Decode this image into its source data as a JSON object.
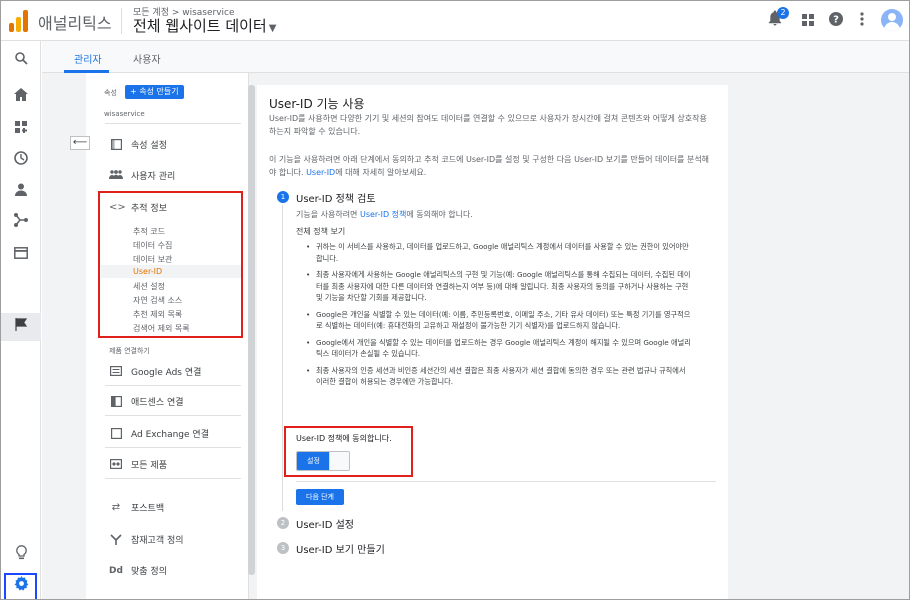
{
  "app": {
    "name": "애널리틱스",
    "breadcrumb": "모든 계정 > wisaservice",
    "property_title": "전체 웹사이트 데이터",
    "notification_count": "2"
  },
  "tabs": [
    "관리자",
    "사용자"
  ],
  "nav": {
    "property_label": "속성",
    "create_button": "+ 속성 만들기",
    "property_name": "wisaservice",
    "items": [
      "속성 설정",
      "사용자 관리",
      "추적 정보"
    ],
    "tracking_sub": [
      "추적 코드",
      "데이터 수집",
      "데이터 보관",
      "User-ID",
      "세션 설정",
      "자연 검색 소스",
      "추천 제외 목록",
      "검색어 제외 목록"
    ],
    "product_links_label": "제품 연결하기",
    "product_links": [
      "Google Ads 연결",
      "애드센스 연결",
      "Ad Exchange 연결",
      "모든 제품"
    ],
    "more_items": [
      "포스트백",
      "잠재고객 정의",
      "맞춤 정의"
    ]
  },
  "main": {
    "title": "User-ID 기능 사용",
    "intro": "User-ID를 사용하면 다양한 기기 및 세션의 참여도 데이터를 연결할 수 있으므로 사용자가 장시간에 걸쳐 콘텐츠와 어떻게 상호작용하는지 파악할 수 있습니다.",
    "desc_before": "이 기능을 사용하려면 아래 단계에서 동의하고 추적 코드에 User-ID를 설정 및 구성한 다음 User-ID 보기를 만들어 데이터를 분석해야 합니다. ",
    "desc_link": "User-ID",
    "desc_after": "에 대해 자세히 알아보세요.",
    "step1": {
      "num": "1",
      "title": "User-ID 정책 검토",
      "desc_before": "기능을 사용하려면 ",
      "desc_link": "User-ID 정책",
      "desc_after": "에 동의해야 합니다.",
      "full_policy": "전체 정책 보기",
      "bullets": [
        "귀하는 이 서비스를 사용하고, 데이터를 업로드하고, Google 애널리틱스 계정에서 데이터를 사용할 수 있는 권한이 있어야만 합니다.",
        "최종 사용자에게 사용하는 Google 애널리틱스의 구현 및 기능(예: Google 애널리틱스를 통해 수집되는 데이터, 수집된 데이터를 최종 사용자에 대한 다른 데이터와 연결하는지 여부 등)에 대해 알립니다. 최종 사용자의 동의를 구하거나 사용하는 구현 및 기능을 차단할 기회를 제공합니다.",
        "Google은 개인을 식별할 수 있는 데이터(예: 이름, 주민등록번호, 이메일 주소, 기타 유사 데이터) 또는 특정 기기를 영구적으로 식별하는 데이터(예: 휴대전화의 고유하고 재설정이 불가능한 기기 식별자)를 업로드하지 않습니다.",
        "Google에서 개인을 식별할 수 있는 데이터를 업로드하는 경우 Google 애널리틱스 계정이 해지될 수 있으며 Google 애널리틱스 데이터가 손실될 수 있습니다.",
        "최종 사용자의 인증 세션과 비인증 세션간의 세션 결합은 최종 사용자가 세션 결합에 동의한 경우 또는 관련 법규나 규칙에서 이러한 결합이 허용되는 경우에만 가능합니다."
      ],
      "agree_label": "User-ID 정책에 동의합니다.",
      "toggle_label": "설정",
      "next_button": "다음 단계"
    },
    "step2": {
      "num": "2",
      "title": "User-ID 설정"
    },
    "step3": {
      "num": "3",
      "title": "User-ID 보기 만들기"
    }
  },
  "colors": {
    "accent": "#1a73e8",
    "highlight_border": "#e0201b",
    "selected_text": "#e37400",
    "gear_box": "#1a49ff"
  },
  "icons": [
    "analytics-logo-icon",
    "notifications-icon",
    "apps-icon",
    "help-icon",
    "more-vert-icon",
    "account-icon",
    "search-icon",
    "home-icon",
    "customization-icon",
    "realtime-icon",
    "audience-icon",
    "acquisition-icon",
    "behavior-icon",
    "conversions-icon",
    "lightbulb-icon",
    "settings-gear-icon"
  ]
}
